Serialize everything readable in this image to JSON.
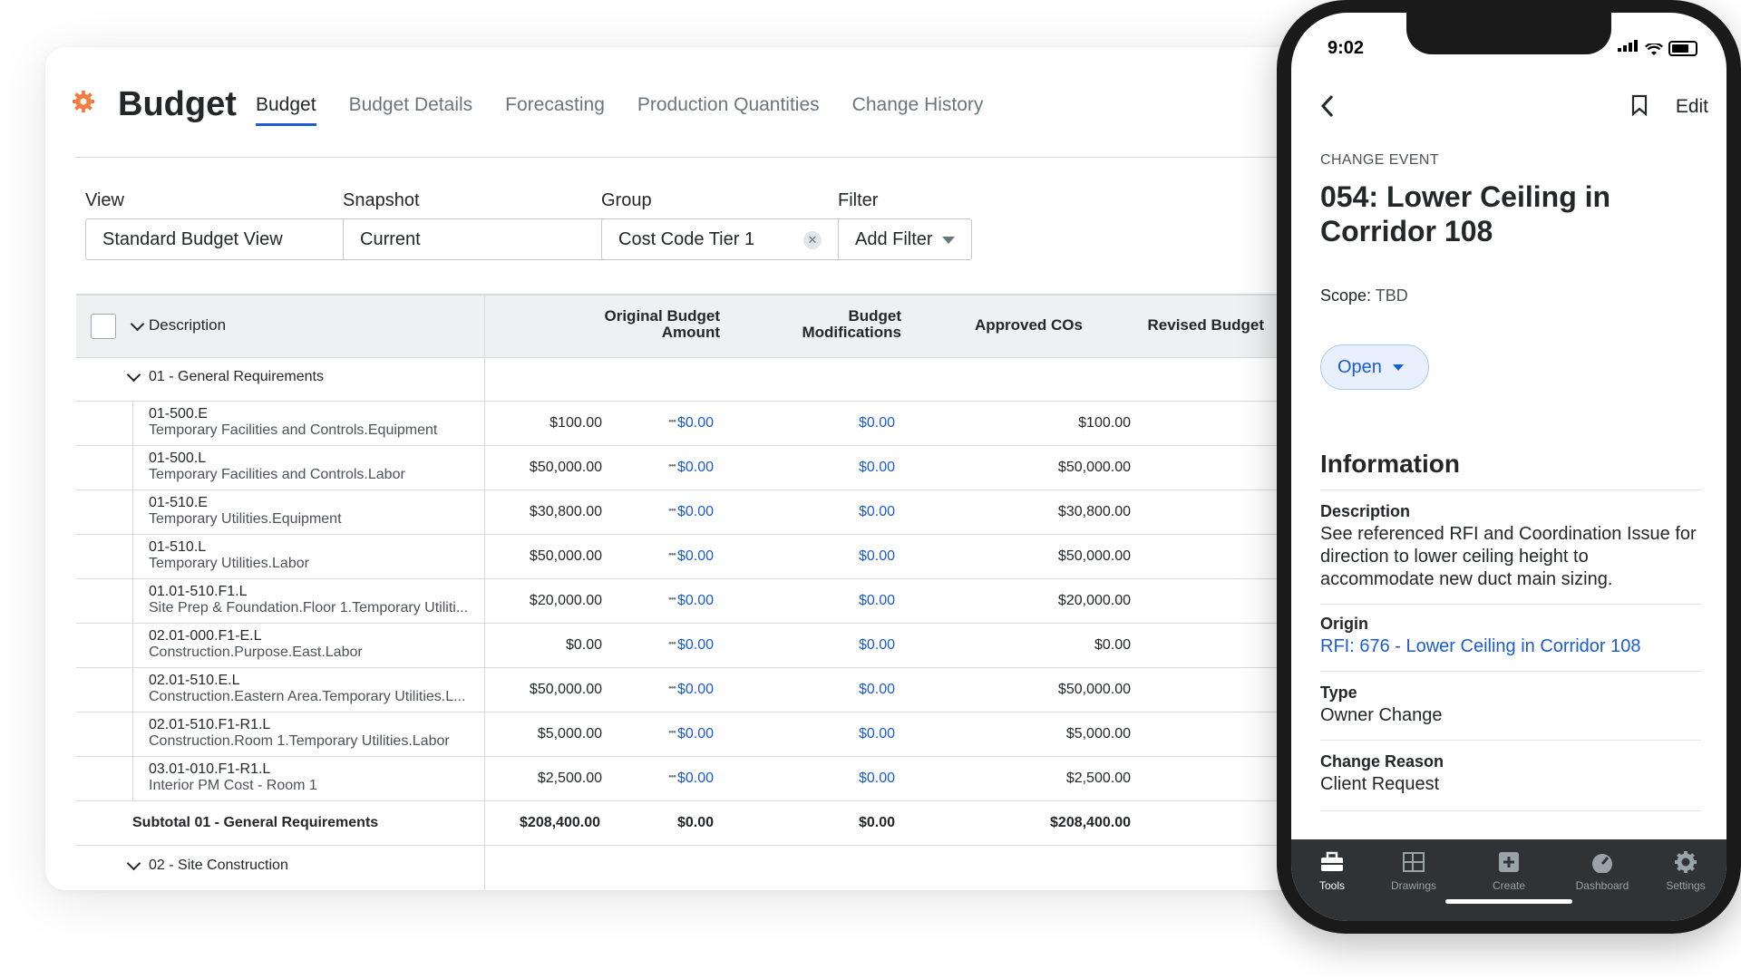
{
  "budget": {
    "app_title": "Budget",
    "tabs": [
      "Budget",
      "Budget Details",
      "Forecasting",
      "Production Quantities",
      "Change History"
    ],
    "filters": {
      "view_label": "View",
      "view_value": "Standard Budget View",
      "snapshot_label": "Snapshot",
      "snapshot_value": "Current",
      "group_label": "Group",
      "group_value": "Cost Code Tier 1",
      "filter_label": "Filter",
      "filter_value": "Add Filter"
    },
    "columns": {
      "description": "Description",
      "original_l1": "Original Budget",
      "original_l2": "Amount",
      "mods_l1": "Budget",
      "mods_l2": "Modifications",
      "approved": "Approved COs",
      "revised": "Revised Budget"
    },
    "group1": "01 - General Requirements",
    "rows": [
      {
        "code": "01-500.E",
        "desc": "Temporary Facilities and Controls.Equipment",
        "original": "$100.00",
        "mods": "$0.00",
        "approved": "$0.00",
        "revised": "$100.00"
      },
      {
        "code": "01-500.L",
        "desc": "Temporary Facilities and Controls.Labor",
        "original": "$50,000.00",
        "mods": "$0.00",
        "approved": "$0.00",
        "revised": "$50,000.00"
      },
      {
        "code": "01-510.E",
        "desc": "Temporary Utilities.Equipment",
        "original": "$30,800.00",
        "mods": "$0.00",
        "approved": "$0.00",
        "revised": "$30,800.00"
      },
      {
        "code": "01-510.L",
        "desc": "Temporary Utilities.Labor",
        "original": "$50,000.00",
        "mods": "$0.00",
        "approved": "$0.00",
        "revised": "$50,000.00"
      },
      {
        "code": "01.01-510.F1.L",
        "desc": "Site Prep & Foundation.Floor 1.Temporary Utiliti...",
        "original": "$20,000.00",
        "mods": "$0.00",
        "approved": "$0.00",
        "revised": "$20,000.00"
      },
      {
        "code": "02.01-000.F1-E.L",
        "desc": "Construction.Purpose.East.Labor",
        "original": "$0.00",
        "mods": "$0.00",
        "approved": "$0.00",
        "revised": "$0.00"
      },
      {
        "code": "02.01-510.E.L",
        "desc": "Construction.Eastern Area.Temporary Utilities.L...",
        "original": "$50,000.00",
        "mods": "$0.00",
        "approved": "$0.00",
        "revised": "$50,000.00"
      },
      {
        "code": "02.01-510.F1-R1.L",
        "desc": "Construction.Room 1.Temporary Utilities.Labor",
        "original": "$5,000.00",
        "mods": "$0.00",
        "approved": "$0.00",
        "revised": "$5,000.00"
      },
      {
        "code": "03.01-010.F1-R1.L",
        "desc": "Interior PM Cost - Room 1",
        "original": "$2,500.00",
        "mods": "$0.00",
        "approved": "$0.00",
        "revised": "$2,500.00"
      }
    ],
    "subtotal": {
      "label": "Subtotal 01 - General Requirements",
      "original": "$208,400.00",
      "mods": "$0.00",
      "approved": "$0.00",
      "revised": "$208,400.00"
    },
    "group2": "02 - Site Construction"
  },
  "phone": {
    "time": "9:02",
    "edit": "Edit",
    "kicker": "CHANGE EVENT",
    "title": "054: Lower Ceiling in Corridor 108",
    "scope_label": "Scope:",
    "scope_value": "TBD",
    "status": "Open",
    "info_heading": "Information",
    "fields": [
      {
        "label": "Description",
        "value": "See referenced RFI and Coordination Issue for direction to lower ceiling height to accommodate new duct main sizing."
      },
      {
        "label": "Origin",
        "value": "RFI: 676 - Lower Ceiling in Corridor 108"
      },
      {
        "label": "Type",
        "value": "Owner Change"
      },
      {
        "label": "Change Reason",
        "value": "Client Request"
      }
    ],
    "tabbar": [
      "Tools",
      "Drawings",
      "Create",
      "Dashboard",
      "Settings"
    ]
  },
  "colors": {
    "accent": "#1b5cd1",
    "brand": "#f47e42",
    "tabbar": "#2f3336"
  }
}
